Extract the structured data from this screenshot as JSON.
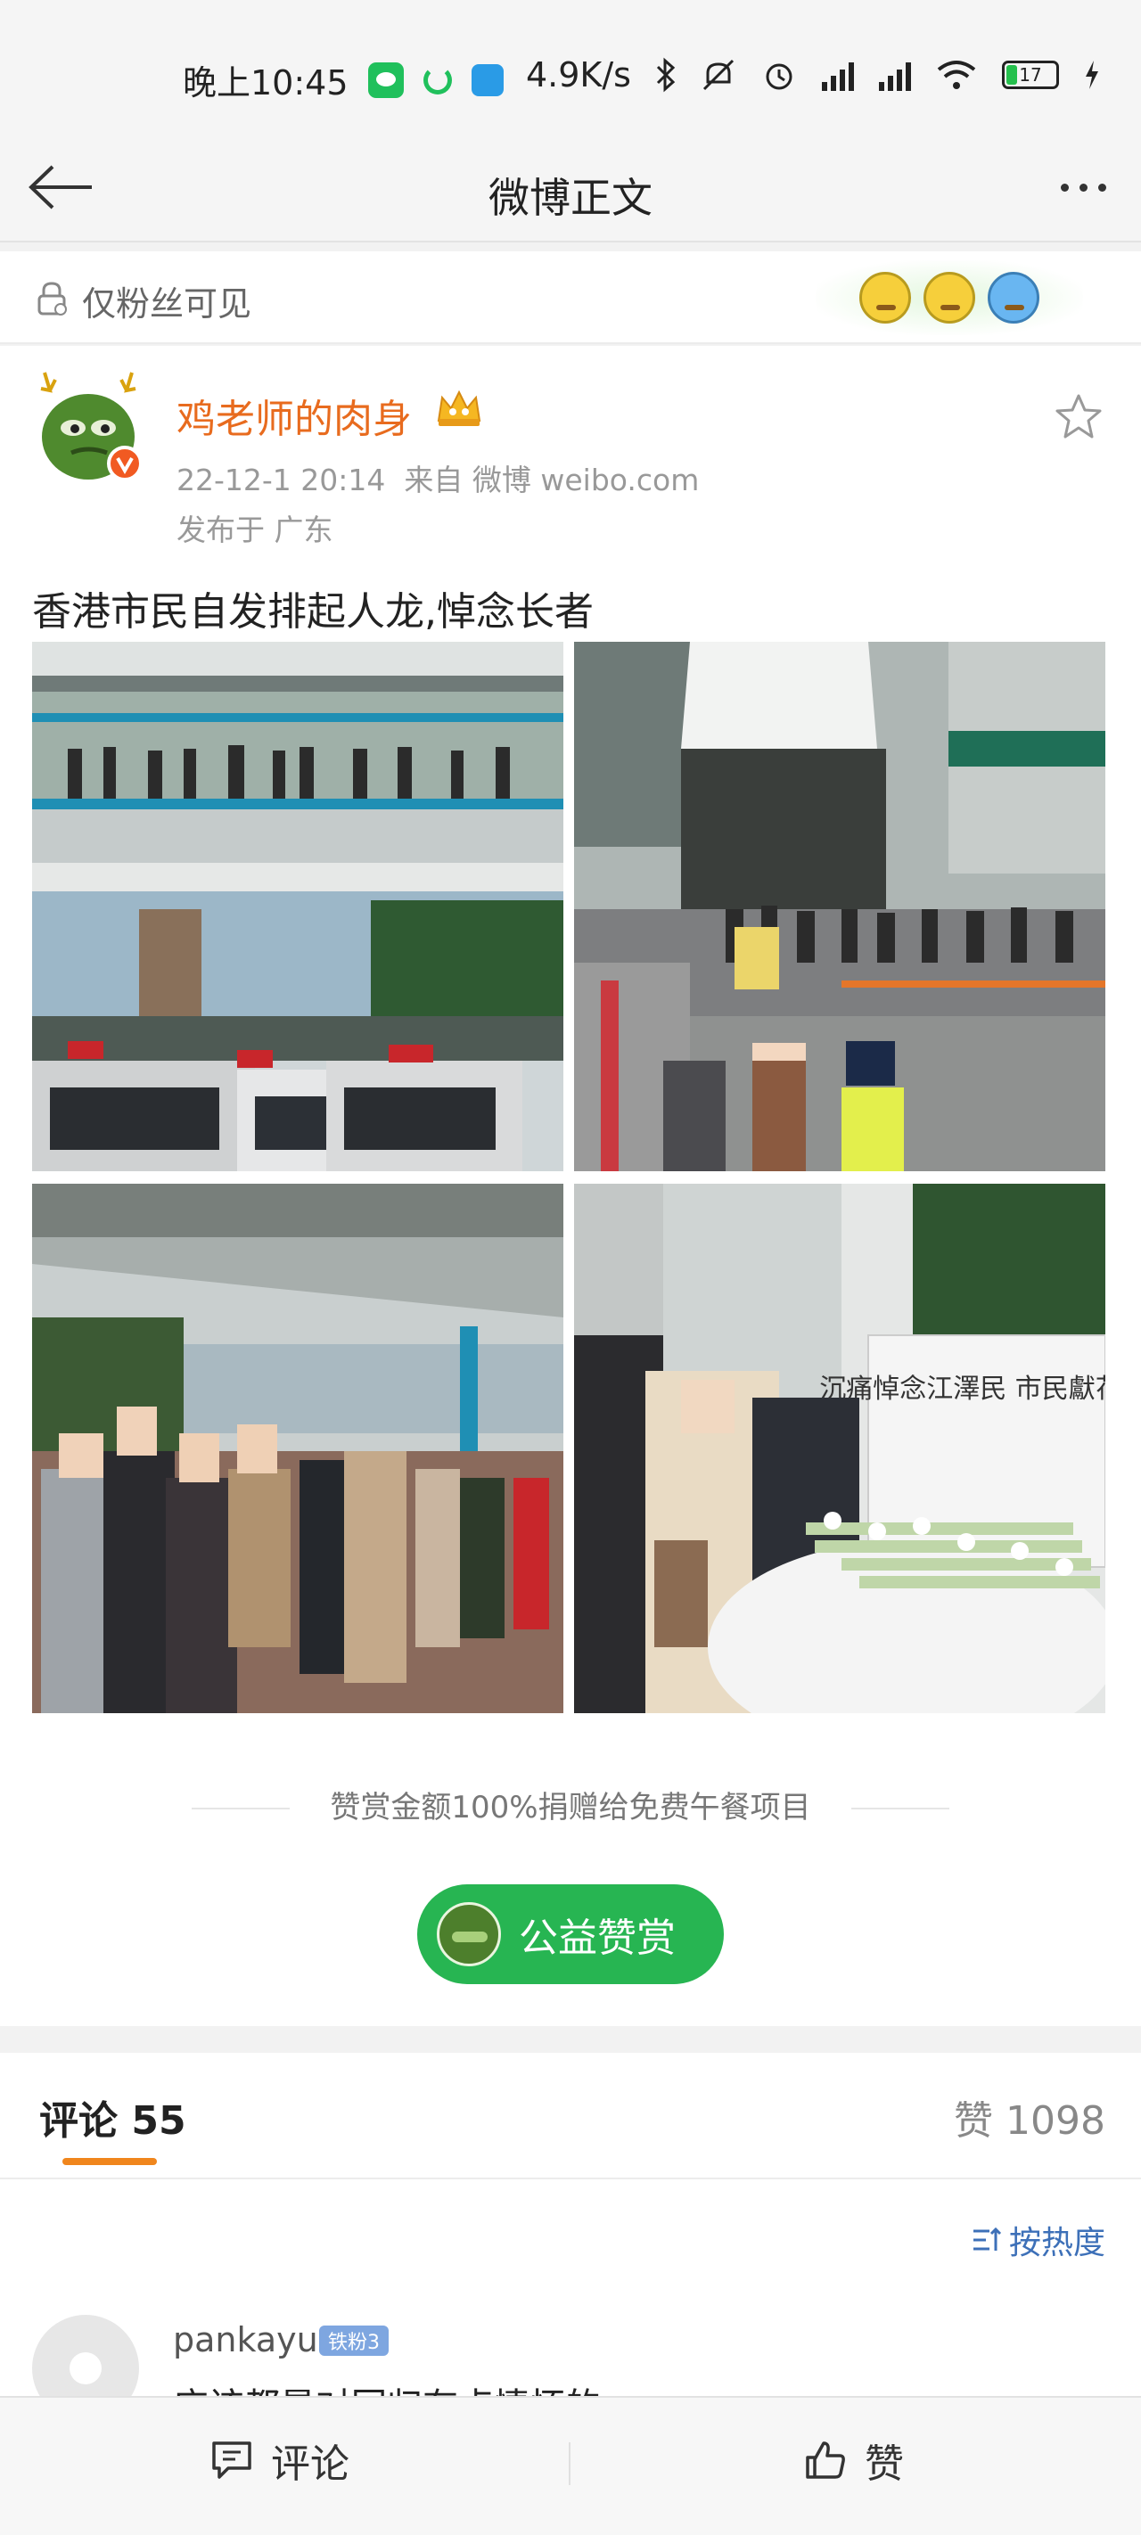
{
  "status_bar": {
    "time": "晚上10:45",
    "network_speed": "4.9K/s",
    "battery": "17",
    "icons": [
      "wechat-icon",
      "sync-icon",
      "telegram-icon",
      "bluetooth-icon",
      "mute-icon",
      "alarm-icon",
      "signal-icon",
      "hd-signal-icon",
      "wifi-icon",
      "battery-icon",
      "charging-icon"
    ]
  },
  "header": {
    "title": "微博正文",
    "back_icon": "back-arrow-icon",
    "more_icon": "more-dots-icon"
  },
  "visibility": {
    "label": "仅粉丝可见"
  },
  "post": {
    "author": "鸡老师的肉身",
    "time": "22-12-1 20:14",
    "source": "来自 微博 weibo.com",
    "location": "发布于 广东",
    "text": "香港市民自发排起人龙,悼念长者",
    "photo_sign_text": "沉痛悼念江澤民 市民獻花處",
    "photos": [
      "footbridge-queue-photo",
      "queue-near-police-photo",
      "street-queue-photo",
      "flower-tribute-photo"
    ],
    "reward_note": "赞赏金额100%捐赠给免费午餐项目",
    "reward_button": "公益赞赏"
  },
  "comments": {
    "tab_label": "评论",
    "count": "55",
    "likes_label": "赞",
    "likes_count": "1098",
    "sort_label": "按热度",
    "first_comment": {
      "user": "pankayu",
      "badge": "铁粉3",
      "text": "应该都是对回归有点情怀的"
    }
  },
  "bottom_bar": {
    "comment_label": "评论",
    "like_label": "赞"
  },
  "colors": {
    "accent_orange": "#e86b1e",
    "reward_green": "#27b552",
    "link_blue": "#3d70b8"
  }
}
